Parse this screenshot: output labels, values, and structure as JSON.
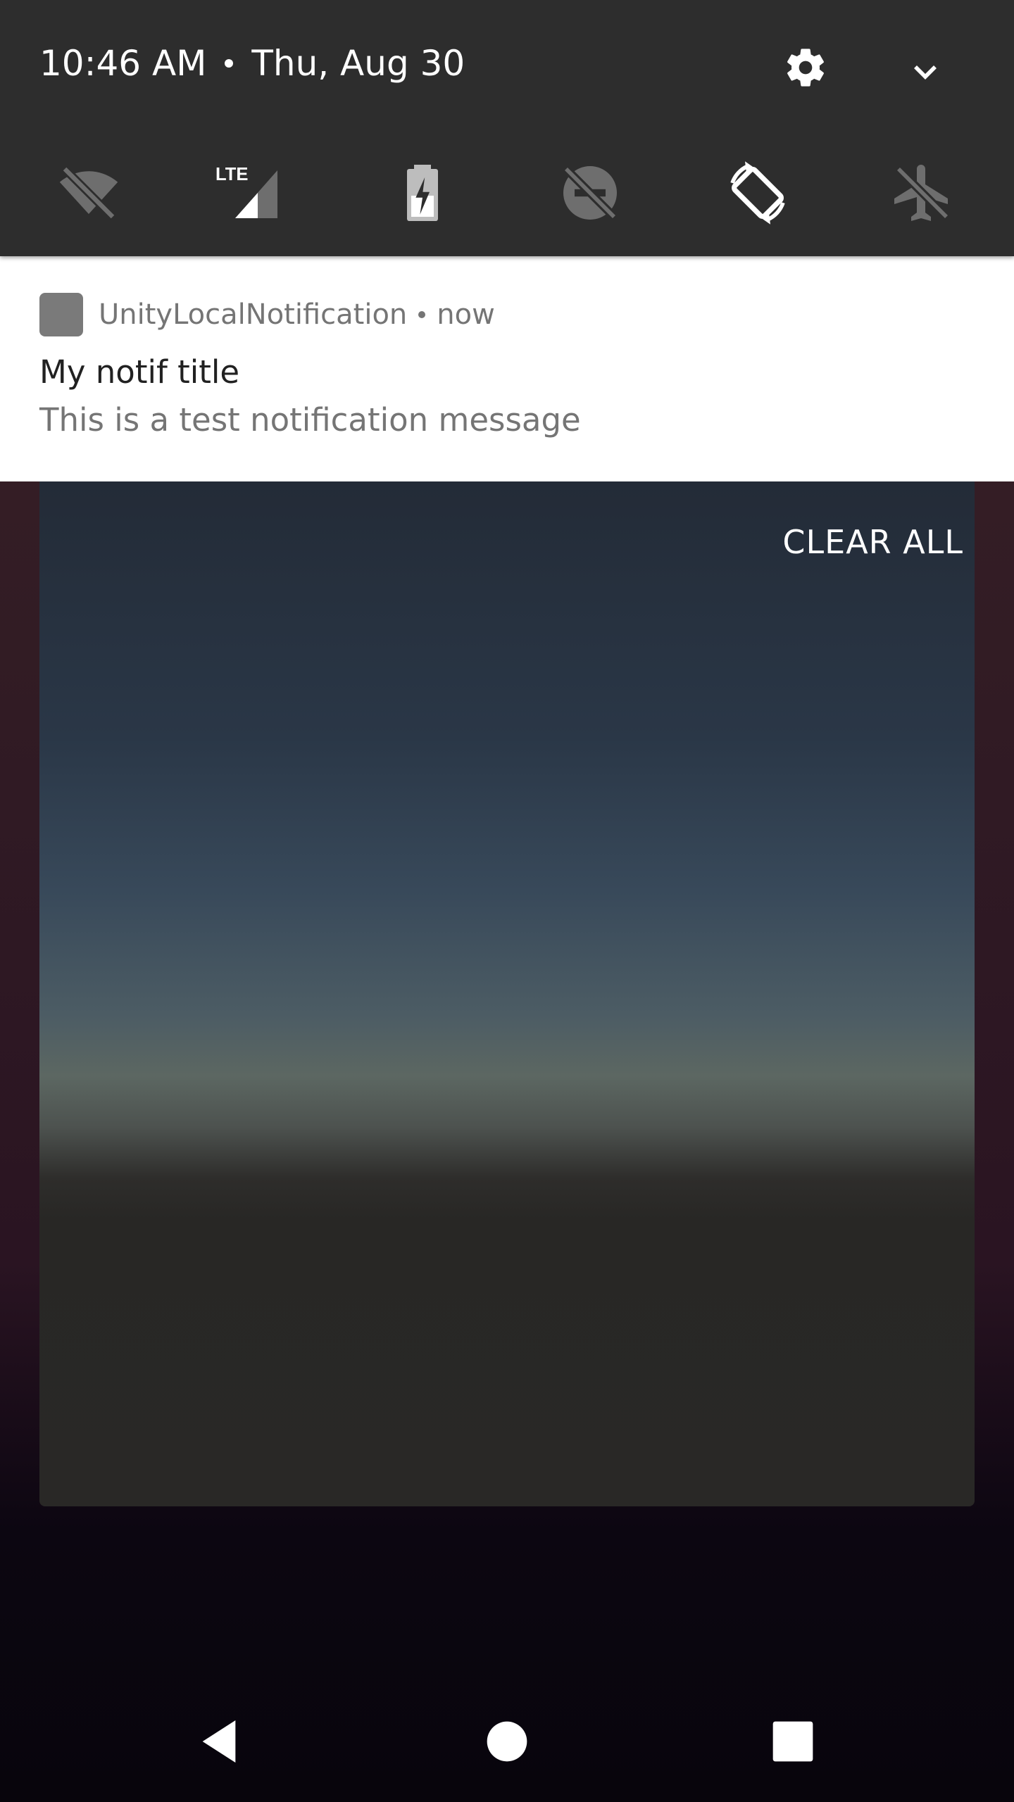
{
  "status": {
    "time": "10:46 AM",
    "date": "Thu, Aug 30"
  },
  "quick_settings": {
    "tiles": [
      {
        "icon": "wifi-off-icon"
      },
      {
        "icon": "lte-signal-icon",
        "label": "LTE"
      },
      {
        "icon": "battery-saver-icon"
      },
      {
        "icon": "do-not-disturb-off-icon"
      },
      {
        "icon": "auto-rotate-icon"
      },
      {
        "icon": "airplane-mode-icon"
      }
    ]
  },
  "notification": {
    "app_name": "UnityLocalNotification",
    "time": "now",
    "title": "My notif title",
    "text": "This is a test notification message"
  },
  "shade": {
    "clear_all_label": "CLEAR ALL"
  },
  "colors": {
    "panel": "#2d2d2d",
    "notification_bg": "#ffffff",
    "app_icon": "#7a7a7a"
  },
  "nav": {
    "buttons": [
      "back-icon",
      "home-icon",
      "recents-icon"
    ]
  }
}
